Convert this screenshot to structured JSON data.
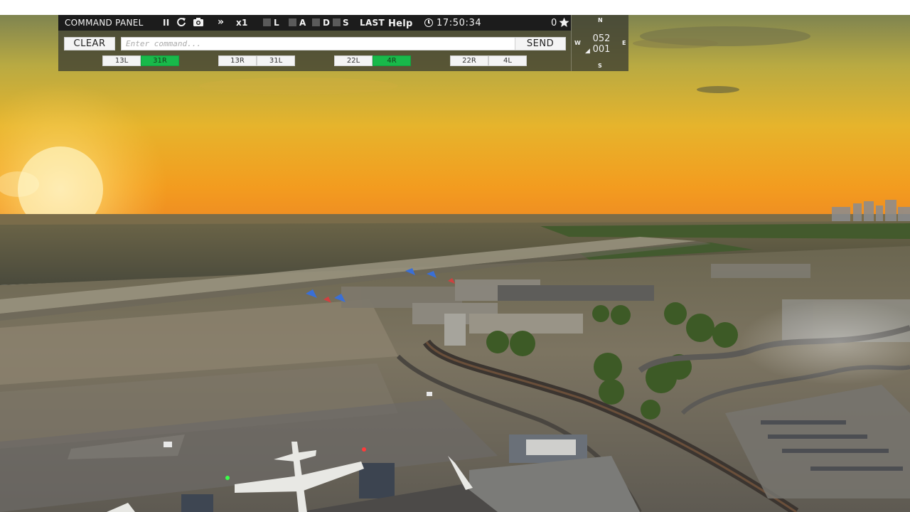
{
  "panel": {
    "title": "COMMAND PANEL",
    "pause_glyph": "II",
    "forward_glyph": "»",
    "speed": "x1",
    "filter_l": "L",
    "filter_a": "A",
    "filter_d": "D",
    "filter_s": "S",
    "last_label": "LAST",
    "help_label": "Help",
    "clock": "17:50:34",
    "score": "0",
    "clear_label": "CLEAR",
    "send_label": "SEND",
    "command_placeholder": "Enter command...",
    "command_value": ""
  },
  "runways": [
    {
      "label": "13L",
      "active": false
    },
    {
      "label": "31R",
      "active": true
    },
    {
      "label": "13R",
      "active": false
    },
    {
      "label": "31L",
      "active": false
    },
    {
      "label": "22L",
      "active": false
    },
    {
      "label": "4R",
      "active": true
    },
    {
      "label": "22R",
      "active": false
    },
    {
      "label": "4L",
      "active": false
    }
  ],
  "compass": {
    "n": "N",
    "s": "S",
    "e": "E",
    "w": "W",
    "heading": "052",
    "secondary": "001"
  },
  "icons": [
    "pause-icon",
    "refresh-icon",
    "camera-icon",
    "fast-forward-icon",
    "clock-icon",
    "star-icon"
  ],
  "colors": {
    "active_runway": "#18b94a",
    "panel_titlebar": "#1c1c1c",
    "sky_top": "#8c8a4a",
    "sky_horizon": "#f29a1e"
  }
}
